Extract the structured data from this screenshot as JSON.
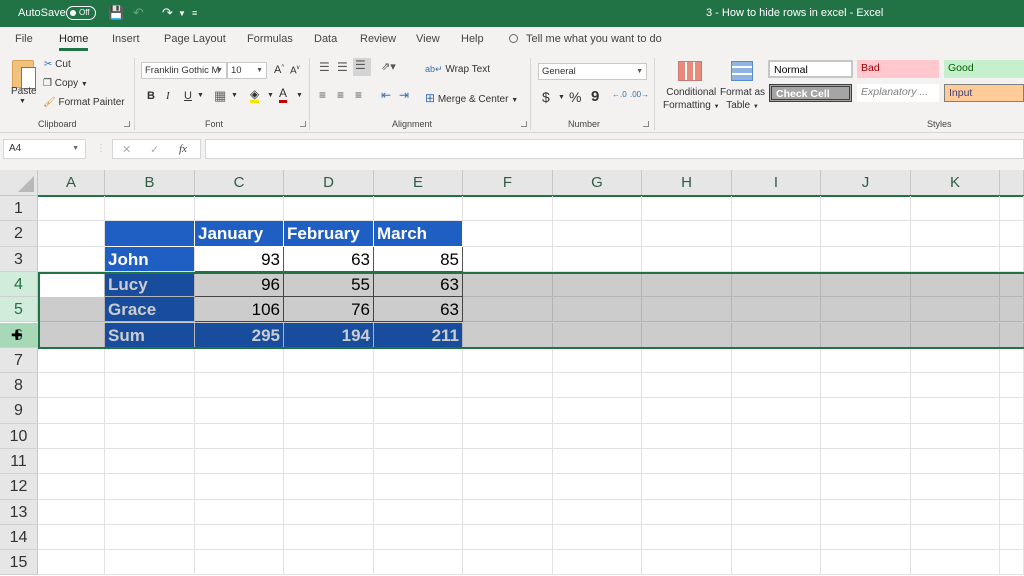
{
  "titlebar": {
    "autosave_label": "AutoSave",
    "autosave_state": "Off",
    "document_title": "3 - How to hide rows in excel  -  Excel"
  },
  "menu": {
    "tabs": [
      "File",
      "Home",
      "Insert",
      "Page Layout",
      "Formulas",
      "Data",
      "Review",
      "View",
      "Help"
    ],
    "active_tab": "Home",
    "tell_me": "Tell me what you want to do"
  },
  "ribbon": {
    "clipboard": {
      "label": "Clipboard",
      "paste": "Paste",
      "cut": "Cut",
      "copy": "Copy",
      "format_painter": "Format Painter"
    },
    "font": {
      "label": "Font",
      "font_name": "Franklin Gothic M",
      "font_size": "10",
      "bold": "B",
      "italic": "I",
      "underline": "U",
      "grow": "A",
      "shrink": "A",
      "font_color": "A"
    },
    "alignment": {
      "label": "Alignment",
      "wrap_text": "Wrap Text",
      "merge_center": "Merge & Center"
    },
    "number": {
      "label": "Number",
      "format": "General",
      "currency": "$",
      "percent": "%",
      "comma": "9"
    },
    "styles": {
      "label": "Styles",
      "conditional_formatting": [
        "Conditional",
        "Formatting"
      ],
      "format_as_table": [
        "Format as",
        "Table"
      ],
      "cell_styles": [
        {
          "name": "Normal",
          "bg": "#ffffff",
          "color": "#000000"
        },
        {
          "name": "Bad",
          "bg": "#ffc7ce",
          "color": "#9c0006"
        },
        {
          "name": "Good",
          "bg": "#c6efce",
          "color": "#006100"
        },
        {
          "name": "Check Cell",
          "bg": "#a5a5a5",
          "color": "#ffffff"
        },
        {
          "name": "Explanatory ...",
          "bg": "#ffffff",
          "color": "#7f7f7f"
        },
        {
          "name": "Input",
          "bg": "#ffcc99",
          "color": "#3f3f76"
        }
      ]
    }
  },
  "formula_bar": {
    "name_box": "A4",
    "cancel": "✕",
    "enter": "✓",
    "fx": "fx",
    "formula": ""
  },
  "sheet": {
    "columns": [
      "A",
      "B",
      "C",
      "D",
      "E",
      "F",
      "G",
      "H",
      "I",
      "J",
      "K"
    ],
    "rows": [
      "1",
      "2",
      "3",
      "4",
      "5",
      "6",
      "7",
      "8",
      "9",
      "10",
      "11",
      "12",
      "13",
      "14",
      "15"
    ],
    "selected_rows": [
      "4",
      "5",
      "6"
    ],
    "active_cell": "A4",
    "table": {
      "headers": [
        "",
        "January",
        "February",
        "March"
      ],
      "body": [
        {
          "name": "John",
          "values": [
            "93",
            "63",
            "85"
          ]
        },
        {
          "name": "Lucy",
          "values": [
            "96",
            "55",
            "63"
          ]
        },
        {
          "name": "Grace",
          "values": [
            "106",
            "76",
            "63"
          ]
        },
        {
          "name": "Sum",
          "values": [
            "295",
            "194",
            "211"
          ]
        }
      ]
    },
    "colors": {
      "accent": "#217346",
      "table_blue": "#1f5fc4"
    }
  }
}
